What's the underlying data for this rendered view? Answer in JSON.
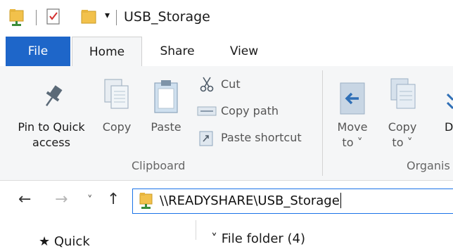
{
  "title_bar": {
    "title": "USB_Storage",
    "customize_glyph": "▾"
  },
  "ribbon_tabs": [
    {
      "label": "File"
    },
    {
      "label": "Home"
    },
    {
      "label": "Share"
    },
    {
      "label": "View"
    }
  ],
  "clipboard_group": {
    "pin_line1": "Pin to Quick",
    "pin_line2": "access",
    "copy": "Copy",
    "paste": "Paste",
    "cut": "Cut",
    "copy_path": "Copy path",
    "paste_shortcut": "Paste shortcut",
    "group_label": "Clipboard"
  },
  "organize_group": {
    "move_to_line1": "Move",
    "move_to_line2": "to ˅",
    "copy_to_line1": "Copy",
    "copy_to_line2": "to ˅",
    "delete_partial": "D",
    "group_label_partial": "Organis"
  },
  "address_bar": {
    "path": "\\\\READYSHARE\\USB_Storage",
    "back_glyph": "←",
    "forward_glyph": "→",
    "recent_glyph": "˅",
    "up_glyph": "↑"
  },
  "content": {
    "nav_partial": "★ Quick",
    "file_folder_header": "˅ File folder (4)"
  },
  "colors": {
    "file_tab": "#1e66c9",
    "ribbon_bg": "#f5f6f7",
    "address_border": "#1a73e8",
    "folder_yellow": "#f2c14b"
  },
  "icons": [
    "folder-icon",
    "properties-icon",
    "new-folder-icon",
    "pin-icon",
    "copy-icon",
    "paste-icon",
    "cut-icon",
    "copy-path-icon",
    "paste-shortcut-icon",
    "move-to-icon",
    "copy-to-icon"
  ]
}
